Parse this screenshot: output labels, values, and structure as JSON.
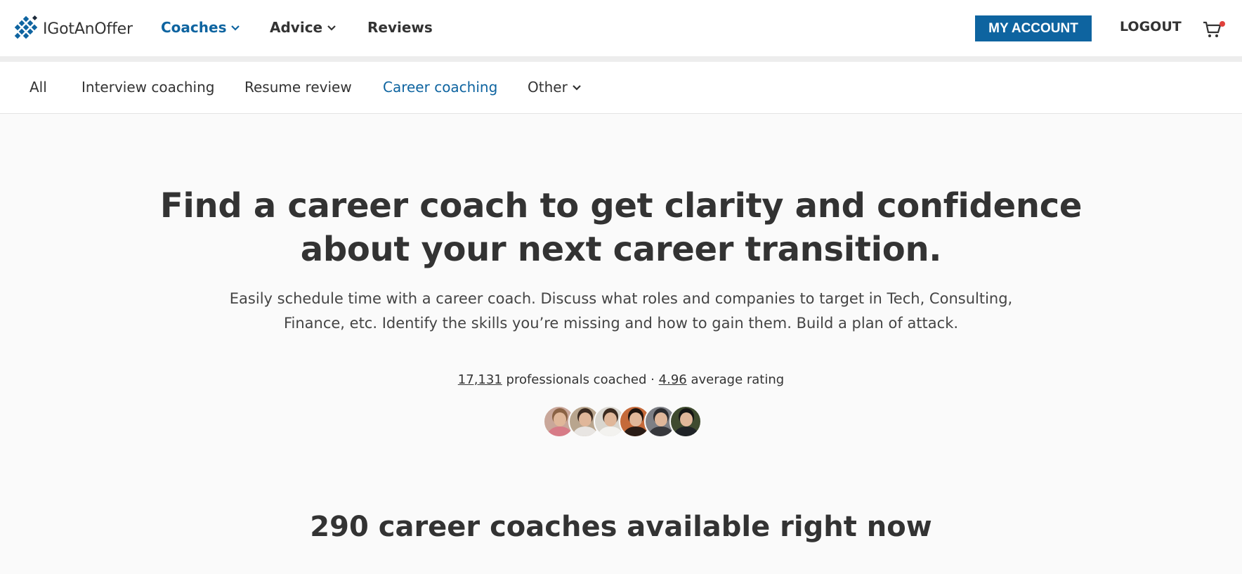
{
  "header": {
    "logo_text": "IGotAnOffer",
    "nav": [
      {
        "label": "Coaches",
        "icon": "chevron-down-icon",
        "active": true
      },
      {
        "label": "Advice",
        "icon": "chevron-down-icon",
        "active": false
      },
      {
        "label": "Reviews",
        "active": false
      }
    ],
    "account_label": "MY ACCOUNT",
    "logout_label": "LOGOUT",
    "cart_icon": "cart-icon",
    "accent_color": "#0e64a0",
    "cart_badge_color": "#e0413c"
  },
  "subnav": {
    "items": [
      {
        "label": "All",
        "active": false
      },
      {
        "label": "Interview coaching",
        "active": false
      },
      {
        "label": "Resume review",
        "active": false
      },
      {
        "label": "Career coaching",
        "active": true
      },
      {
        "label": "Other",
        "icon": "chevron-down-icon",
        "active": false
      }
    ]
  },
  "hero": {
    "title_line1": "Find a career coach to get clarity and confidence",
    "title_line2": "about your next career transition.",
    "subtitle_line1": "Easily schedule time with a career coach. Discuss what roles and companies to target in Tech, Consulting,",
    "subtitle_line2": "Finance, etc. Identify the skills you’re missing and how to gain them. Build a plan of attack.",
    "stats": {
      "professionals_count": "17,131",
      "professionals_label": "professionals coached",
      "separator": "·",
      "rating": "4.96",
      "rating_label": "average rating"
    },
    "avatars": [
      {
        "name": "coach-avatar-1",
        "bg": "#c9a79a",
        "hair": "#8a6244",
        "shirt": "#d77b87"
      },
      {
        "name": "coach-avatar-2",
        "bg": "#b8a58e",
        "hair": "#3a2a20",
        "shirt": "#e8e5e2"
      },
      {
        "name": "coach-avatar-3",
        "bg": "#d9d6cf",
        "hair": "#3b2a1f",
        "shirt": "#f3f2ef"
      },
      {
        "name": "coach-avatar-4",
        "bg": "#c56a3a",
        "hair": "#1e140f",
        "shirt": "#2a1c16"
      },
      {
        "name": "coach-avatar-5",
        "bg": "#7d7f85",
        "hair": "#2b2b2e",
        "shirt": "#37383c"
      },
      {
        "name": "coach-avatar-6",
        "bg": "#3f4b2f",
        "hair": "#161615",
        "shirt": "#1f2327"
      }
    ]
  },
  "listing": {
    "count": "290",
    "count_label": "career coaches available right now"
  }
}
